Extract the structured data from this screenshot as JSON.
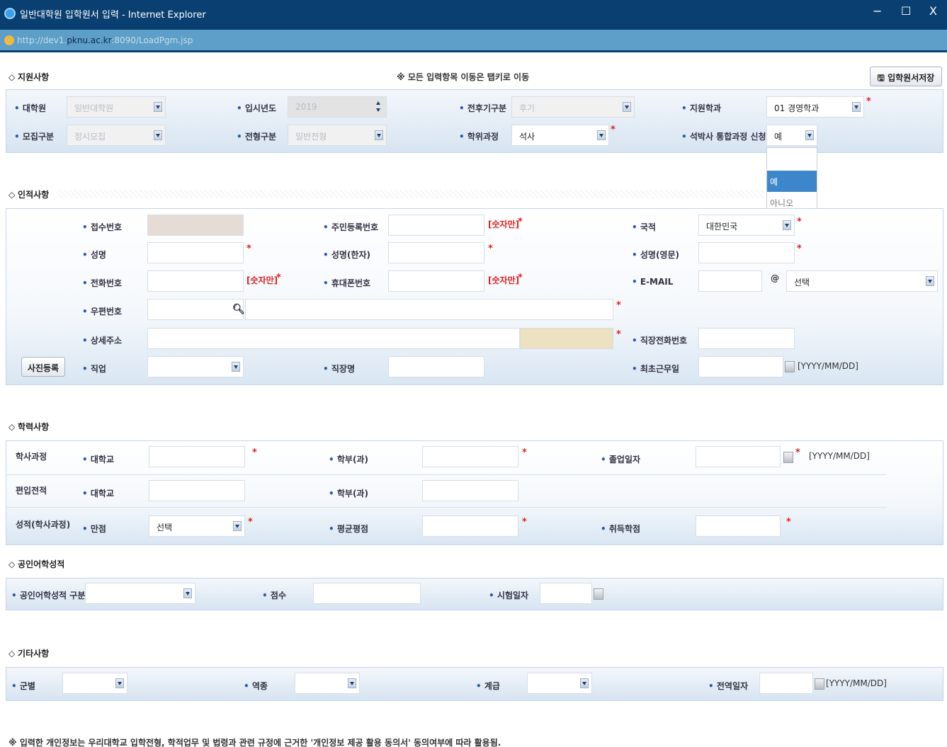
{
  "window": {
    "title": "일반대학원 입학원서 입력 - Internet Explorer",
    "controls": [
      "−",
      "☐",
      "X"
    ]
  },
  "address_bar": {
    "prefix": "http://dev1.",
    "host": "pknu.ac.kr",
    "suffix": ":8090/LoadPgm.jsp"
  },
  "apply": {
    "section_title": "지원사항",
    "notice": "※ 모든 입력항목 이동은 탭키로 이동",
    "save_button": "입학원서저장",
    "fields": {
      "school_label": "대학원",
      "school_value": "일반대학원",
      "year_label": "입시년도",
      "year_value": "2019",
      "period_label": "전후기구분",
      "period_value": "후기",
      "dept_label": "지원학과",
      "dept_value": "01 경영학과",
      "recruit_label": "모집구분",
      "recruit_value": "정시모집",
      "type_label": "전형구분",
      "type_value": "일반전형",
      "degree_label": "학위과정",
      "degree_value": "석사",
      "integrated_label": "석박사 통합과정 신청",
      "integrated_value": "예"
    },
    "integrated_options": [
      "",
      "예",
      "아니오"
    ]
  },
  "personal": {
    "section_title": "인적사항",
    "photo_button": "사진등록",
    "receipt_no": "접수번호",
    "resident_no": "주민등록번호",
    "resident_hint": "[숫자만]",
    "nation": "국적",
    "nation_value": "대한민국",
    "name": "성명",
    "name_hanja": "성명(한자)",
    "name_eng": "성명(영문)",
    "phone": "전화번호",
    "phone_hint": "[숫자만]",
    "mobile": "휴대폰번호",
    "mobile_hint": "[숫자만]",
    "email": "E-MAIL",
    "email_at": "@",
    "email_domain": "선택",
    "zip": "우편번호",
    "address": "상세주소",
    "work_phone": "직장전화번호",
    "job": "직업",
    "workplace": "직장명",
    "first_work_date": "최초근무일",
    "date_format": "[YYYY/MM/DD]"
  },
  "academic": {
    "section_title": "학력사항",
    "bachelor": "학사과정",
    "transfer": "편입전적",
    "grades": "성적(학사과정)",
    "university": "대학교",
    "major": "학부(과)",
    "grad_date": "졸업일자",
    "date_format": "[YYYY/MM/DD]",
    "full_score": "만점",
    "full_score_value": "선택",
    "gpa": "평균평점",
    "credits": "취득학점"
  },
  "language": {
    "section_title": "공인어학성적",
    "kind": "공인어학성적 구분",
    "score": "점수",
    "test_date": "시험일자"
  },
  "etc": {
    "section_title": "기타사항",
    "military": "군별",
    "branch": "역종",
    "rank": "계급",
    "discharge": "전역일자",
    "date_format": "[YYYY/MM/DD]"
  },
  "footer_note": "※ 입력한 개인정보는 우리대학교 입학전형, 학적업무 및 법령과 관련 규정에 근거한 '개인정보 제공 활용 동의서' 동의여부에 따라 활용됨."
}
